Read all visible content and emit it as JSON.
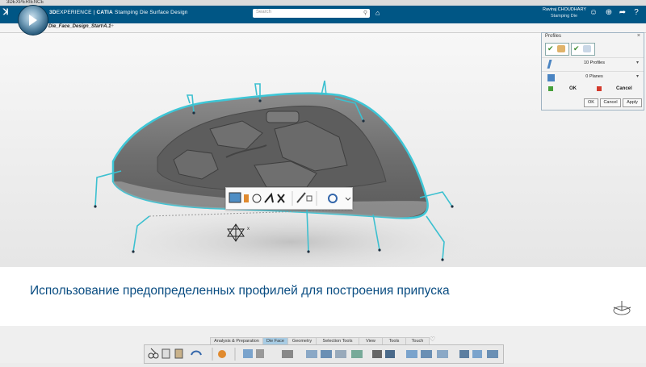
{
  "os": {
    "title": "3DEXPERIENCE"
  },
  "app": {
    "brand_prefix": "3D",
    "brand_exp": "EXPERIENCE",
    "brand_sep": " | ",
    "brand_catia": "CATIA",
    "app_name": "Stamping Die Surface Design",
    "user_name": "Raviraj CHOUDHARY",
    "role": "Stamping Die",
    "search_placeholder": "Search"
  },
  "tabs": {
    "active": "Die_Face_Design_Start A.1",
    "close_glyph": "×",
    "add_glyph": "+"
  },
  "profiles_panel": {
    "title": "Profiles",
    "close_glyph": "×",
    "row1_label": "10 Profiles",
    "row2_label": "0 Planes",
    "ok_label": "OK",
    "cancel_label": "Cancel",
    "btn_ok": "OK",
    "btn_cancel": "Cancel",
    "btn_apply": "Apply"
  },
  "caption": {
    "text": "Использование предопределенных профилей для построения припуска"
  },
  "action_tabs": [
    {
      "label": "Analysis & Preparation"
    },
    {
      "label": "Die Face",
      "selected": true
    },
    {
      "label": "Geometry"
    },
    {
      "label": "Selection Tools"
    },
    {
      "label": "View"
    },
    {
      "label": "Tools"
    },
    {
      "label": "Touch"
    }
  ],
  "colors": {
    "topbar": "#005685",
    "accent_cyan": "#3cc0d0",
    "caption_text": "#0a4d82",
    "selected_tab": "#a8cce4"
  }
}
